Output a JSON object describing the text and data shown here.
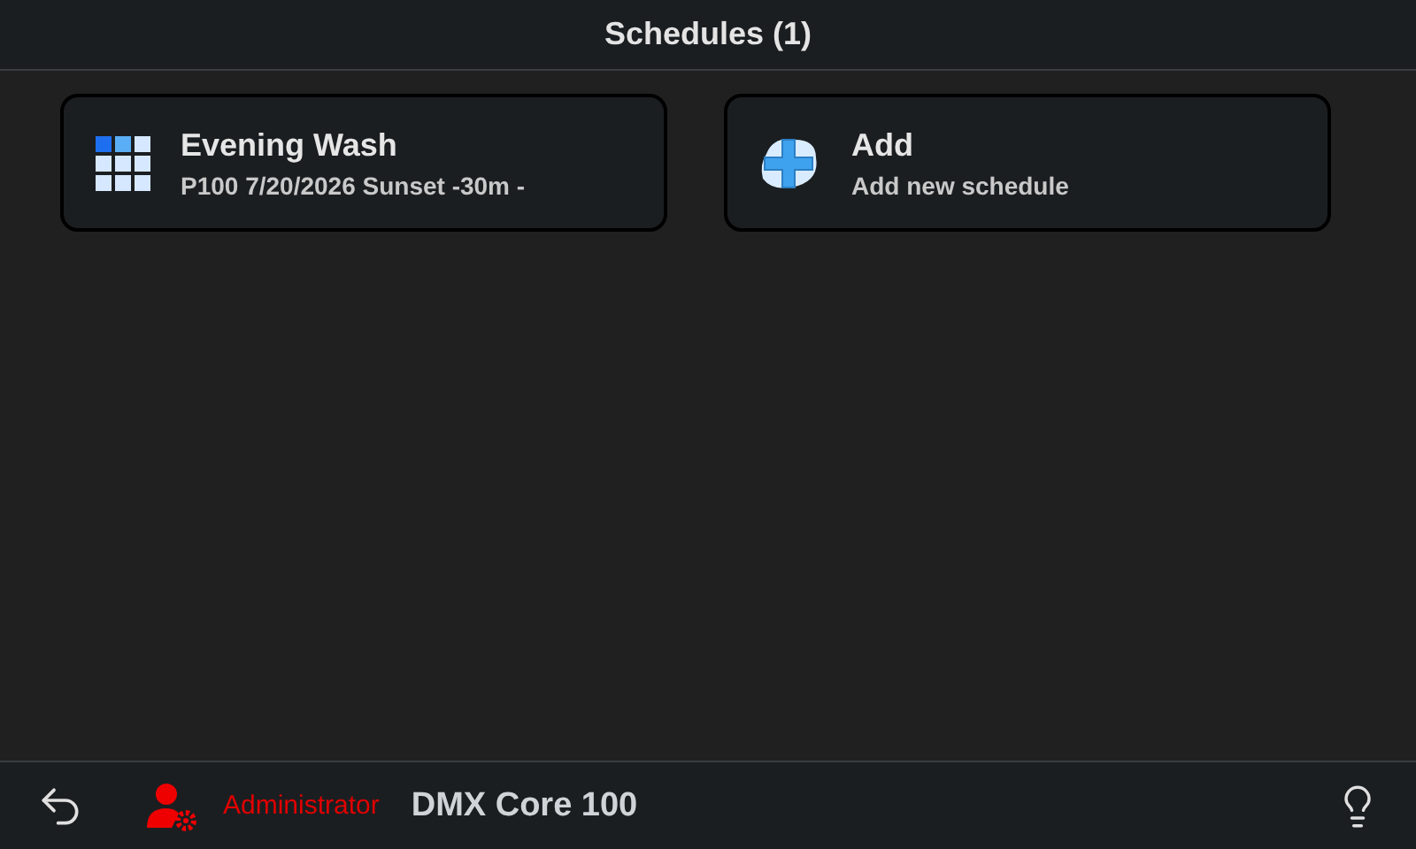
{
  "header": {
    "title": "Schedules (1)"
  },
  "cards": [
    {
      "kind": "schedule",
      "title": "Evening Wash",
      "subtitle": "P100 7/20/2026 Sunset -30m -"
    },
    {
      "kind": "add",
      "title": "Add",
      "subtitle": "Add new schedule"
    }
  ],
  "footer": {
    "user": "Administrator",
    "device": "DMX Core 100"
  }
}
